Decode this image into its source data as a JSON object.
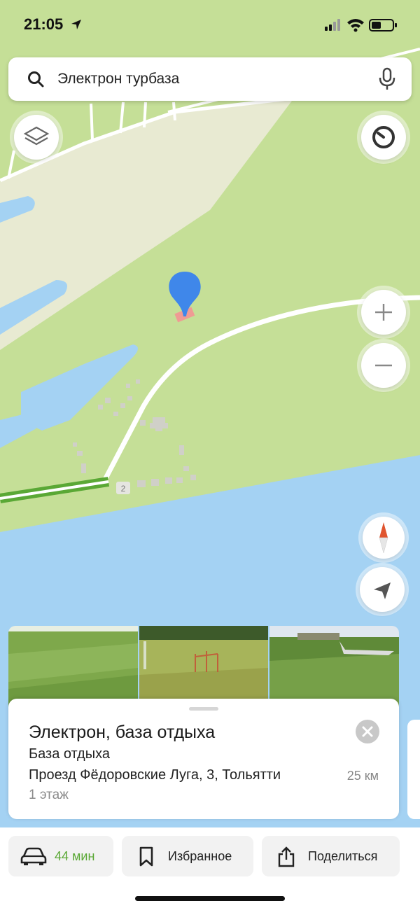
{
  "status_bar": {
    "time": "21:05"
  },
  "search": {
    "query": "Электрон турбаза"
  },
  "map": {
    "house_number_label": "2",
    "colors": {
      "land": "#c5df97",
      "water": "#a4d2f3",
      "sand": "#e8ead2",
      "road": "#ffffff",
      "marker": "#3f87ea",
      "building": "#ef9b94"
    },
    "controls": [
      "layers",
      "speedometer",
      "zoom-in",
      "zoom-out",
      "compass",
      "my-location"
    ]
  },
  "place": {
    "photos": [
      "photo-field",
      "photo-playground",
      "photo-aircraft"
    ],
    "name": "Электрон, база отдыха",
    "category": "База отдыха",
    "address": "Проезд Фёдоровские Луга, 3, Тольятти",
    "distance": "25 км",
    "floor": "1 этаж"
  },
  "actions": {
    "route_time": "44 мин",
    "favorites": "Избранное",
    "share": "Поделиться",
    "accent": "#5aa835"
  }
}
